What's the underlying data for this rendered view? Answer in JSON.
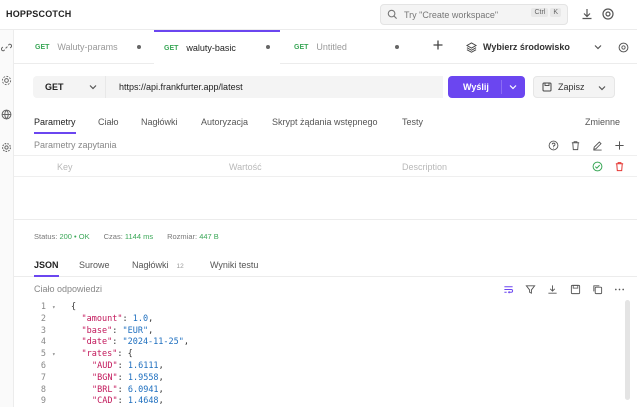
{
  "app": {
    "name": "HOPPSCOTCH"
  },
  "search": {
    "placeholder": "Try \"Create workspace\"",
    "kbd1": "Ctrl",
    "kbd2": "K"
  },
  "tabs": [
    {
      "method": "GET",
      "label": "Waluty-params",
      "active": false
    },
    {
      "method": "GET",
      "label": "waluty-basic",
      "active": true
    },
    {
      "method": "GET",
      "label": "Untitled",
      "active": false
    }
  ],
  "environment": {
    "label": "Wybierz środowisko"
  },
  "request": {
    "method": "GET",
    "url": "https://api.frankfurter.app/latest",
    "send_label": "Wyślij",
    "save_label": "Zapisz"
  },
  "request_tabs": [
    "Parametry",
    "Ciało",
    "Nagłówki",
    "Autoryzacja",
    "Skrypt żądania wstępnego",
    "Testy"
  ],
  "variables_label": "Zmienne",
  "params": {
    "title": "Parametry zapytania",
    "key_placeholder": "Key",
    "value_placeholder": "Wartość",
    "description_placeholder": "Description"
  },
  "status": {
    "status_label": "Status:",
    "status_value": "200 • OK",
    "time_label": "Czas:",
    "time_value": "1144 ms",
    "size_label": "Rozmiar:",
    "size_value": "447 B"
  },
  "response_tabs": [
    {
      "label": "JSON",
      "active": true,
      "badge": ""
    },
    {
      "label": "Surowe",
      "active": false,
      "badge": ""
    },
    {
      "label": "Nagłówki",
      "active": false,
      "badge": "12"
    },
    {
      "label": "Wyniki testu",
      "active": false,
      "badge": ""
    }
  ],
  "response": {
    "title": "Ciało odpowiedzi",
    "lines": [
      {
        "n": "1",
        "fold": true,
        "indent": 0,
        "key": "",
        "value": "",
        "text": "{"
      },
      {
        "n": "2",
        "fold": false,
        "indent": 1,
        "key": "\"amount\"",
        "value": "1.0",
        "vtype": "num",
        "tail": ","
      },
      {
        "n": "3",
        "fold": false,
        "indent": 1,
        "key": "\"base\"",
        "value": "\"EUR\"",
        "vtype": "str",
        "tail": ","
      },
      {
        "n": "4",
        "fold": false,
        "indent": 1,
        "key": "\"date\"",
        "value": "\"2024-11-25\"",
        "vtype": "str",
        "tail": ","
      },
      {
        "n": "5",
        "fold": true,
        "indent": 1,
        "key": "\"rates\"",
        "value": "{",
        "vtype": "punct",
        "tail": ""
      },
      {
        "n": "6",
        "fold": false,
        "indent": 2,
        "key": "\"AUD\"",
        "value": "1.6111",
        "vtype": "num",
        "tail": ","
      },
      {
        "n": "7",
        "fold": false,
        "indent": 2,
        "key": "\"BGN\"",
        "value": "1.9558",
        "vtype": "num",
        "tail": ","
      },
      {
        "n": "8",
        "fold": false,
        "indent": 2,
        "key": "\"BRL\"",
        "value": "6.0941",
        "vtype": "num",
        "tail": ","
      },
      {
        "n": "9",
        "fold": false,
        "indent": 2,
        "key": "\"CAD\"",
        "value": "1.4648",
        "vtype": "num",
        "tail": ","
      }
    ]
  },
  "colors": {
    "accent": "#6b46f0",
    "method_green": "#3aa757",
    "json_key": "#c2185b",
    "json_value": "#1e6fbf"
  },
  "icons": [
    "search-icon",
    "download-icon",
    "help-icon",
    "link-icon",
    "settings-icon",
    "globe-icon",
    "layers-icon",
    "help-circle-icon",
    "trash-icon",
    "edit-icon",
    "plus-icon",
    "check-icon",
    "wrap-icon",
    "filter-icon",
    "save-icon",
    "copy-icon",
    "more-icon"
  ]
}
